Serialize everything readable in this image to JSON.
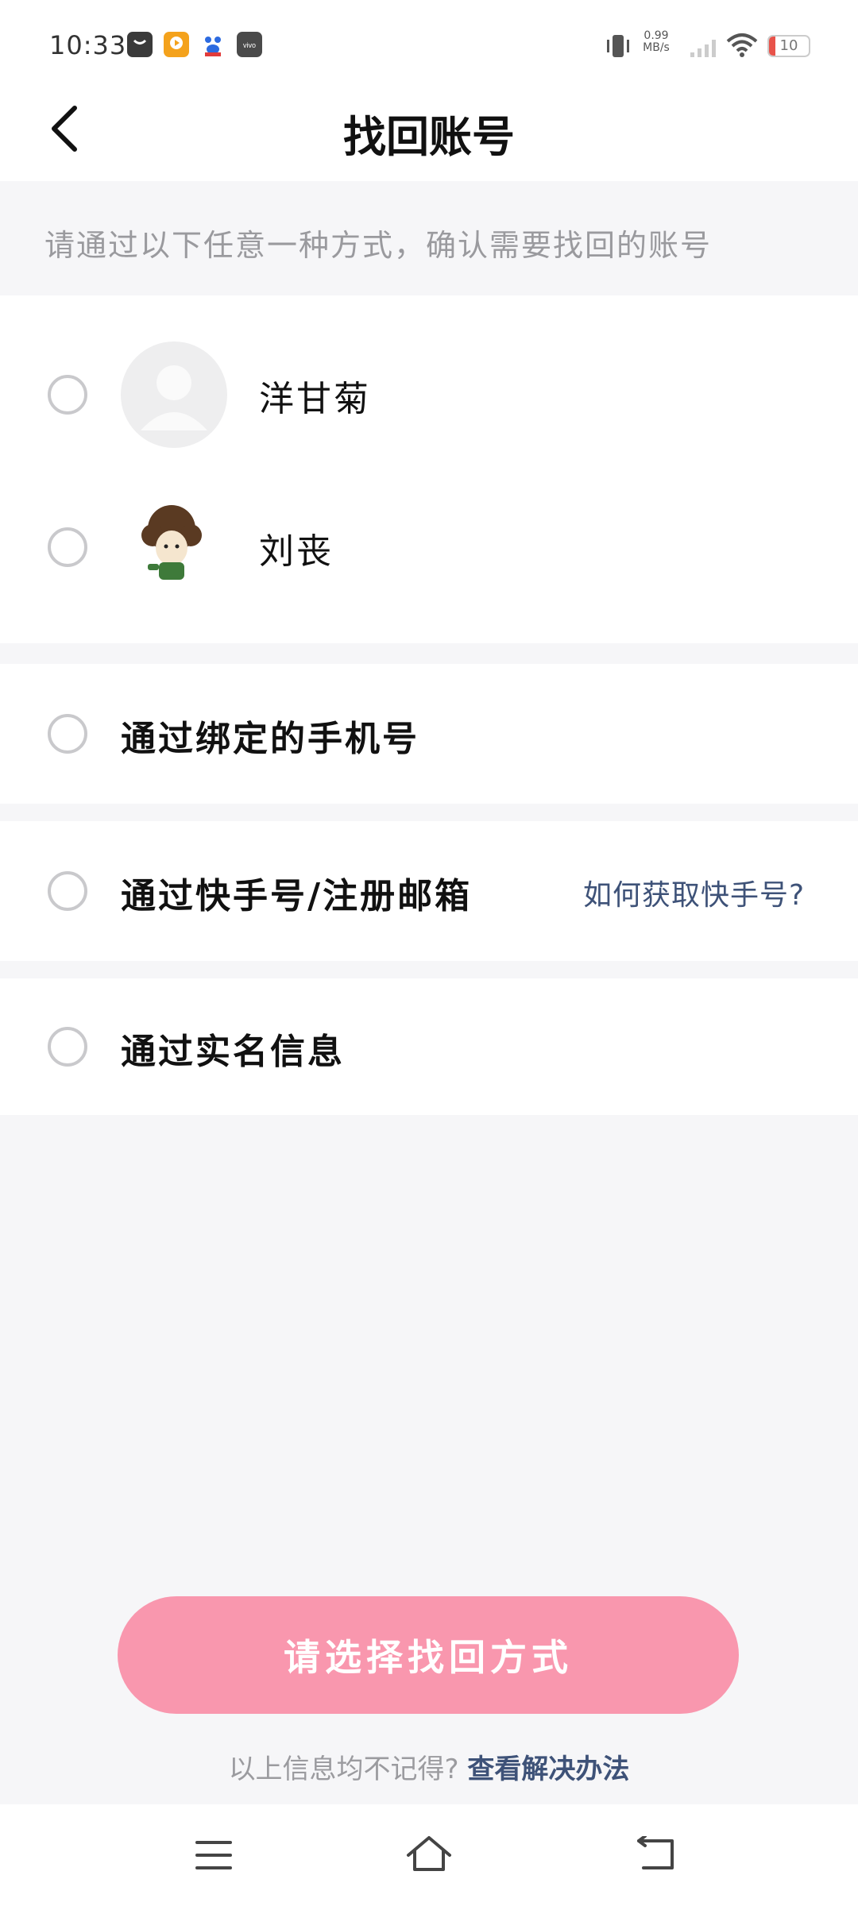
{
  "status_bar": {
    "time": "10:33",
    "net_speed_value": "0.99",
    "net_speed_unit": "MB/s",
    "battery": "10"
  },
  "header": {
    "title": "找回账号"
  },
  "hint": "请通过以下任意一种方式，确认需要找回的账号",
  "accounts": [
    {
      "name": "洋甘菊",
      "avatar": "default-avatar-icon"
    },
    {
      "name": "刘丧",
      "avatar": "cartoon-avatar"
    }
  ],
  "options": {
    "phone": "通过绑定的手机号",
    "kuaishou_id": "通过快手号/注册邮箱",
    "help_link": "如何获取快手号?",
    "real_name": "通过实名信息"
  },
  "submit_label": "请选择找回方式",
  "footer": {
    "question": "以上信息均不记得?",
    "link": "查看解决办法"
  },
  "colors": {
    "accent_pink": "#f997ae",
    "link_blue": "#3e5278",
    "battery_red": "#e8534a"
  }
}
